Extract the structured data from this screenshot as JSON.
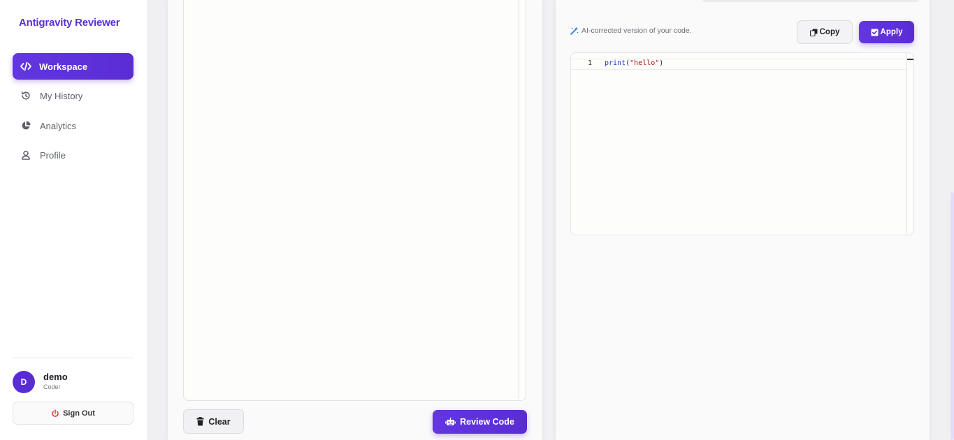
{
  "app": {
    "title": "Antigravity Reviewer"
  },
  "sidebar": {
    "items": [
      {
        "label": "Workspace",
        "icon": "code-icon",
        "active": true
      },
      {
        "label": "My History",
        "icon": "history-icon",
        "active": false
      },
      {
        "label": "Analytics",
        "icon": "pie-chart-icon",
        "active": false
      },
      {
        "label": "Profile",
        "icon": "user-icon",
        "active": false
      }
    ],
    "user": {
      "initial": "D",
      "name": "demo",
      "role": "Coder"
    },
    "signout_label": "Sign Out"
  },
  "editor": {
    "clear_label": "Clear",
    "review_label": "Review Code"
  },
  "result": {
    "hint": "AI-corrected version of your code.",
    "copy_label": "Copy",
    "apply_label": "Apply",
    "code_lines": [
      {
        "number": "1",
        "fn": "print",
        "open": "(",
        "str": "\"hello\"",
        "close": ")"
      }
    ]
  },
  "colors": {
    "accent": "#5a2dd4",
    "brand": "#5a30d8",
    "signout_icon": "#e03131",
    "hint_icon": "#2d7be5"
  }
}
